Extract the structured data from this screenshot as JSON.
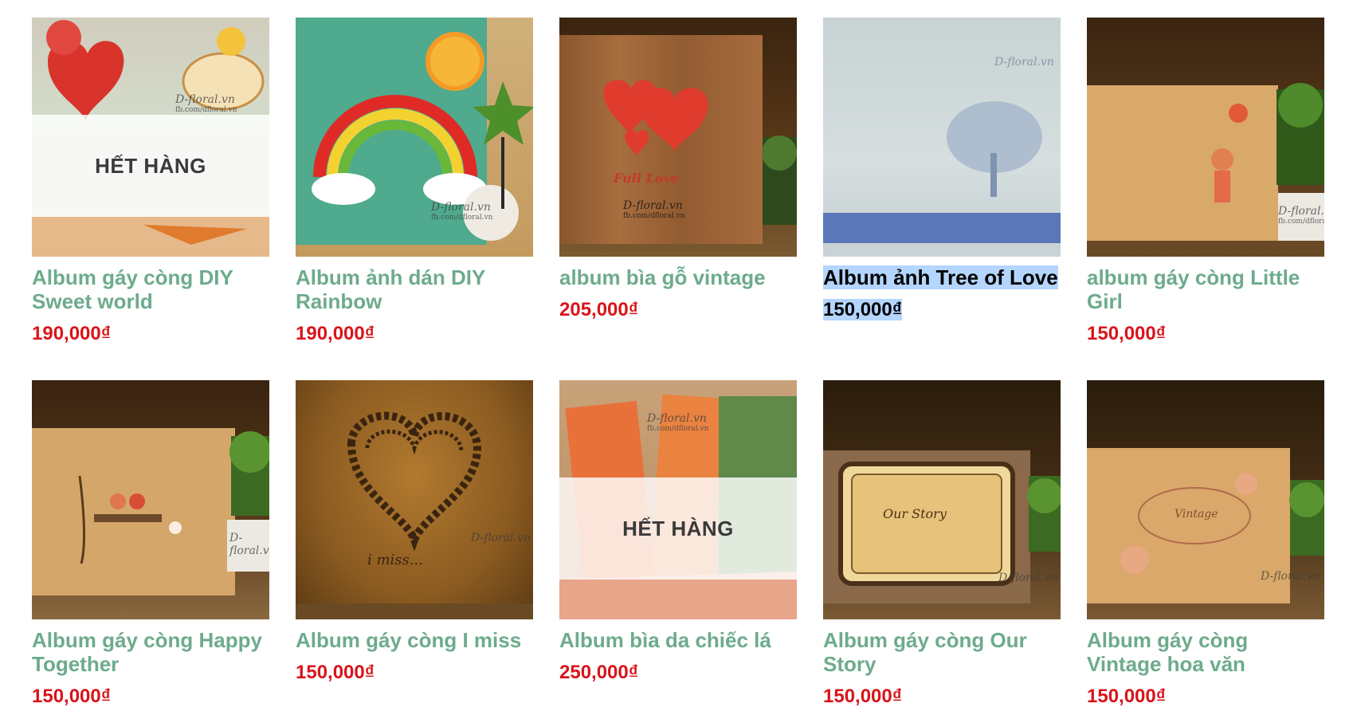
{
  "products": [
    {
      "name": "Album gáy còng DIY Sweet world",
      "price": "190,000₫",
      "badge": "HẾT HÀNG",
      "image": "album-sweet-world-photo"
    },
    {
      "name": "Album ảnh dán DIY Rainbow",
      "price": "190,000₫",
      "badge": "",
      "image": "album-rainbow-photo"
    },
    {
      "name": "album bìa gỗ vintage",
      "price": "205,000₫",
      "badge": "",
      "image": "album-wood-vintage-photo"
    },
    {
      "name": "Album ảnh Tree of Love",
      "price": "150,000₫",
      "badge": "",
      "image": "album-tree-of-love-photo"
    },
    {
      "name": "album gáy còng Little Girl",
      "price": "150,000₫",
      "badge": "",
      "image": "album-little-girl-photo"
    },
    {
      "name": "Album gáy còng Happy Together",
      "price": "150,000₫",
      "badge": "",
      "image": "album-happy-together-photo"
    },
    {
      "name": "Album gáy còng I miss",
      "price": "150,000₫",
      "badge": "",
      "image": "album-i-miss-photo"
    },
    {
      "name": "Album bìa da chiếc lá",
      "price": "250,000₫",
      "badge": "HẾT HÀNG",
      "image": "album-leather-leaf-photo"
    },
    {
      "name": "Album gáy còng Our Story",
      "price": "150,000₫",
      "badge": "",
      "image": "album-our-story-photo"
    },
    {
      "name": "Album gáy còng Vintage hoa văn",
      "price": "150,000₫",
      "badge": "",
      "image": "album-vintage-pattern-photo"
    }
  ],
  "image_text": {
    "watermark": "D-floral.vn",
    "watermark_sub": "fb.com/dfloral.vn",
    "full_love": "Full Love",
    "i_miss": "i miss...",
    "our_story": "Our Story",
    "vintage": "Vintage"
  },
  "selection": {
    "selected_product_index": 3
  },
  "colors": {
    "name": "#6dab8c",
    "price": "#d9141a",
    "selection": "#b4d5fe"
  }
}
